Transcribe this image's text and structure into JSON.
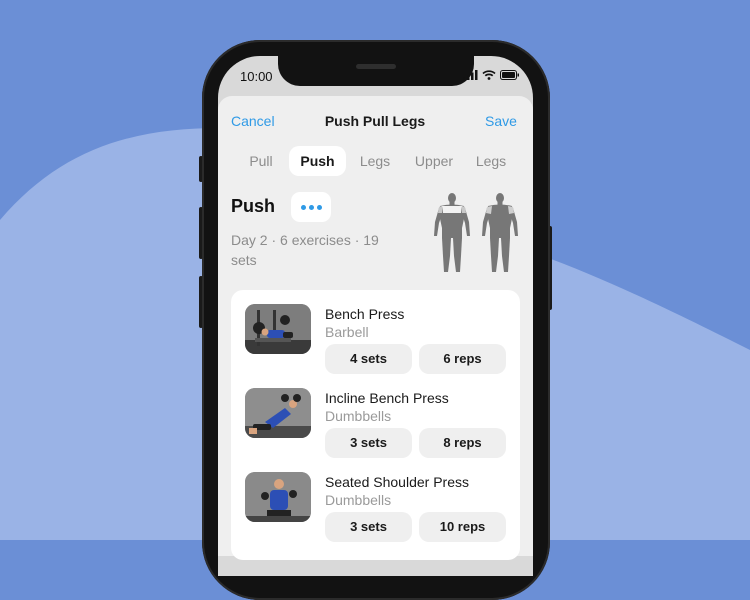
{
  "status_bar": {
    "time": "10:00"
  },
  "nav": {
    "cancel": "Cancel",
    "title": "Push Pull Legs",
    "save": "Save"
  },
  "tabs": [
    {
      "label": "Pull",
      "active": false
    },
    {
      "label": "Push",
      "active": true
    },
    {
      "label": "Legs",
      "active": false
    },
    {
      "label": "Upper",
      "active": false
    },
    {
      "label": "Legs",
      "active": false
    }
  ],
  "day": {
    "title": "Push",
    "meta": "Day 2 · 6 exercises · 19 sets"
  },
  "exercises": [
    {
      "name": "Bench Press",
      "equipment": "Barbell",
      "sets": "4 sets",
      "reps": "6 reps"
    },
    {
      "name": "Incline Bench Press",
      "equipment": "Dumbbells",
      "sets": "3 sets",
      "reps": "8 reps"
    },
    {
      "name": "Seated Shoulder Press",
      "equipment": "Dumbbells",
      "sets": "3 sets",
      "reps": "10 reps"
    }
  ],
  "colors": {
    "accent": "#2f9ae6",
    "background": "#6b8fd6",
    "background_light": "#9ab3e6"
  }
}
